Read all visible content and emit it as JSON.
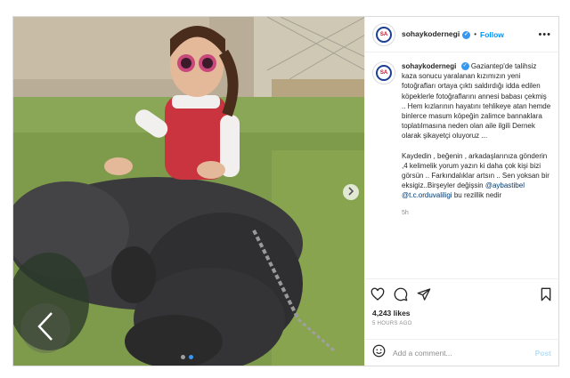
{
  "post": {
    "username": "sohaykodernegi",
    "follow_label": "Follow",
    "separator": "•",
    "more_label": "•••",
    "verified_mark": "✓",
    "logo_text": "SA",
    "caption": {
      "username": "sohaykodernegi",
      "para1": "Gaziantep'de talihsiz kaza sonucu yaralanan kızımızın yeni fotoğrafları ortaya çıktı saldırdığı idda edilen köpeklerle fotoğraflarını annesi babası çekmiş .. Hem kızlarının hayatını tehlikeye atan hemde binlerce masum köpeğin zalimce bannaklara toplatılmasına neden olan aile ilgili Dernek olarak şikayetçi oluyoruz ...",
      "para2_text": "Kaydedin , beğenin , arkadaşlarınıza gönderin ,4 kelimelik yorum yazın ki daha çok kişi bizi görsün .. Farkındalıklar artsın .. Sen yoksan bir eksigiz..Birşeyler değişsin",
      "mention1": "@aybastibel",
      "mention2": "@t.c.orduvaliligi",
      "para2_tail": "bu rezillik nedir",
      "time": "5h"
    },
    "likes": "4,243 likes",
    "time_ago": "5 HOURS AGO",
    "comment_placeholder": "Add a comment...",
    "post_label": "Post"
  },
  "icons": [
    "heart-icon",
    "comment-icon",
    "share-icon",
    "bookmark-icon",
    "emoji-icon",
    "chevron-left-icon",
    "chevron-right-icon",
    "verified-icon"
  ],
  "colors": {
    "link": "#0095f6",
    "mention": "#00376b",
    "muted": "#8e8e8e",
    "post_disabled": "#b2dffc"
  }
}
